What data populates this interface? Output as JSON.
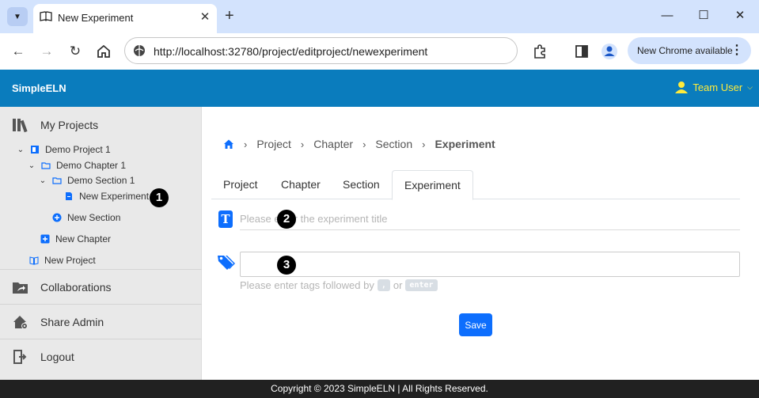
{
  "browser": {
    "tab_title": "New Experiment",
    "url": "http://localhost:32780/project/editproject/newexperiment",
    "update_label": "New Chrome available"
  },
  "app": {
    "brand": "SimpleELN",
    "user_label": "Team User"
  },
  "sidebar": {
    "my_projects": "My Projects",
    "tree": {
      "project": "Demo Project 1",
      "chapter": "Demo Chapter 1",
      "section": "Demo Section 1",
      "experiment": "New Experiment",
      "new_section": "New Section",
      "new_chapter": "New Chapter",
      "new_project": "New Project"
    },
    "collaborations": "Collaborations",
    "share_admin": "Share Admin",
    "logout": "Logout"
  },
  "callouts": {
    "one": "1",
    "two": "2",
    "three": "3"
  },
  "breadcrumb": {
    "project": "Project",
    "chapter": "Chapter",
    "section": "Section",
    "experiment": "Experiment"
  },
  "tabs": [
    "Project",
    "Chapter",
    "Section",
    "Experiment"
  ],
  "form": {
    "title_placeholder": "Please enter the experiment title",
    "title_icon": "T",
    "tags_help_prefix": "Please enter tags followed by",
    "tags_help_key1": ",",
    "tags_help_or": "or",
    "tags_help_key2": "enter",
    "save_label": "Save"
  },
  "footer": {
    "copyright": "Copyright © 2023 SimpleELN | All Rights Reserved."
  },
  "colors": {
    "header_bg": "#0a7cbd",
    "accent": "#0d6efd",
    "user_color": "#ffeb3b",
    "footer_bg": "#212121"
  }
}
